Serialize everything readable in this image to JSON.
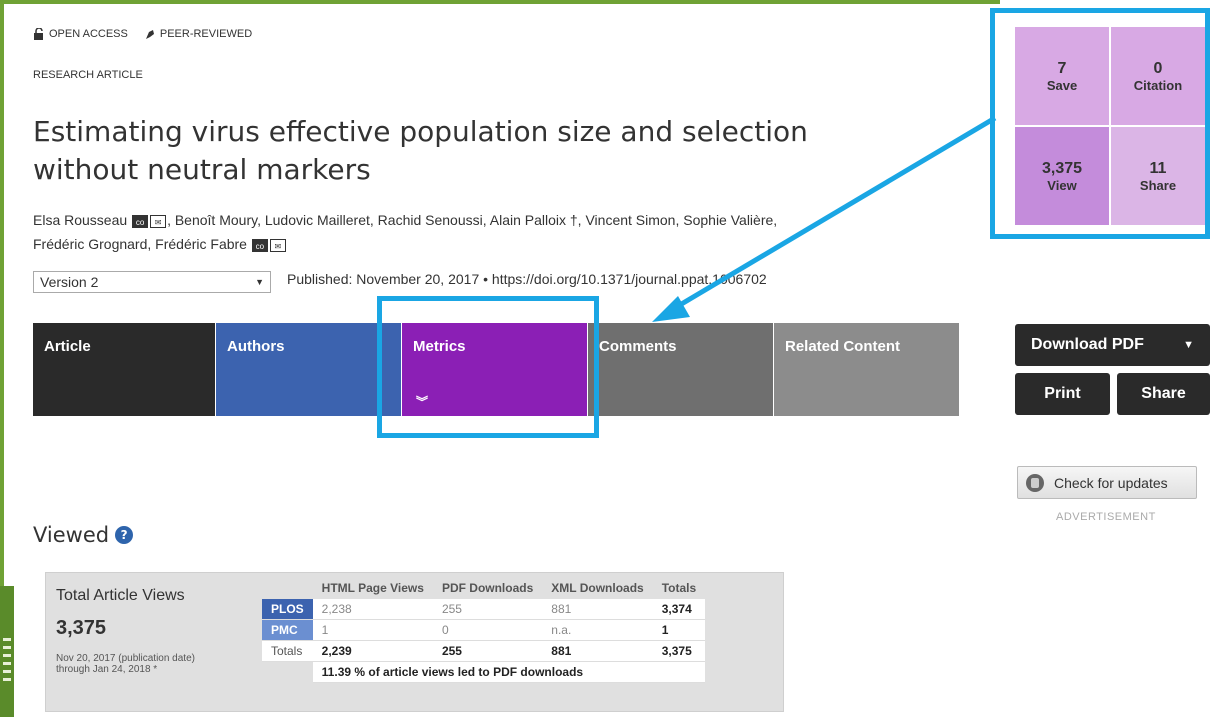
{
  "badges": {
    "open_access": "OPEN ACCESS",
    "peer_reviewed": "PEER-REVIEWED"
  },
  "article_type": "RESEARCH ARTICLE",
  "title": "Estimating virus effective population size and selection without neutral markers",
  "authors": {
    "a1": "Elsa Rousseau",
    "rest1": ", Benoît Moury, Ludovic Mailleret, Rachid Senoussi, Alain Palloix †, Vincent Simon, Sophie Valière,",
    "a_last": "Frédéric Grognard, Frédéric Fabre",
    "icon_cc": "co"
  },
  "version": {
    "selected": "Version 2"
  },
  "published": "Published: November 20, 2017  •  https://doi.org/10.1371/journal.ppat.1006702",
  "tabs": [
    {
      "label": "Article"
    },
    {
      "label": "Authors"
    },
    {
      "label": "Metrics"
    },
    {
      "label": "Comments"
    },
    {
      "label": "Related Content"
    }
  ],
  "counts": {
    "save": {
      "num": "7",
      "label": "Save"
    },
    "citation": {
      "num": "0",
      "label": "Citation"
    },
    "view": {
      "num": "3,375",
      "label": "View"
    },
    "share": {
      "num": "11",
      "label": "Share"
    }
  },
  "actions": {
    "download": "Download PDF",
    "print": "Print",
    "share": "Share"
  },
  "check_updates": "Check for updates",
  "advertisement": "ADVERTISEMENT",
  "viewed": {
    "heading": "Viewed",
    "total_label": "Total Article Views",
    "total_num": "3,375",
    "range_line1": "Nov 20, 2017 (publication date)",
    "range_line2": "through Jan 24, 2018 *",
    "headers": [
      "",
      "HTML Page Views",
      "PDF Downloads",
      "XML Downloads",
      "Totals"
    ],
    "rows": [
      {
        "src": "PLOS",
        "html": "2,238",
        "pdf": "255",
        "xml": "881",
        "total": "3,374"
      },
      {
        "src": "PMC",
        "html": "1",
        "pdf": "0",
        "xml": "n.a.",
        "total": "1"
      },
      {
        "src": "Totals",
        "html": "2,239",
        "pdf": "255",
        "xml": "881",
        "total": "3,375"
      }
    ],
    "note": "11.39 % of article views led to PDF downloads"
  },
  "colors": {
    "accent_green": "#6fa235",
    "highlight_blue": "#1aa6e4",
    "metrics_purple": "#8b1fb5",
    "authors_blue": "#3c63af"
  }
}
